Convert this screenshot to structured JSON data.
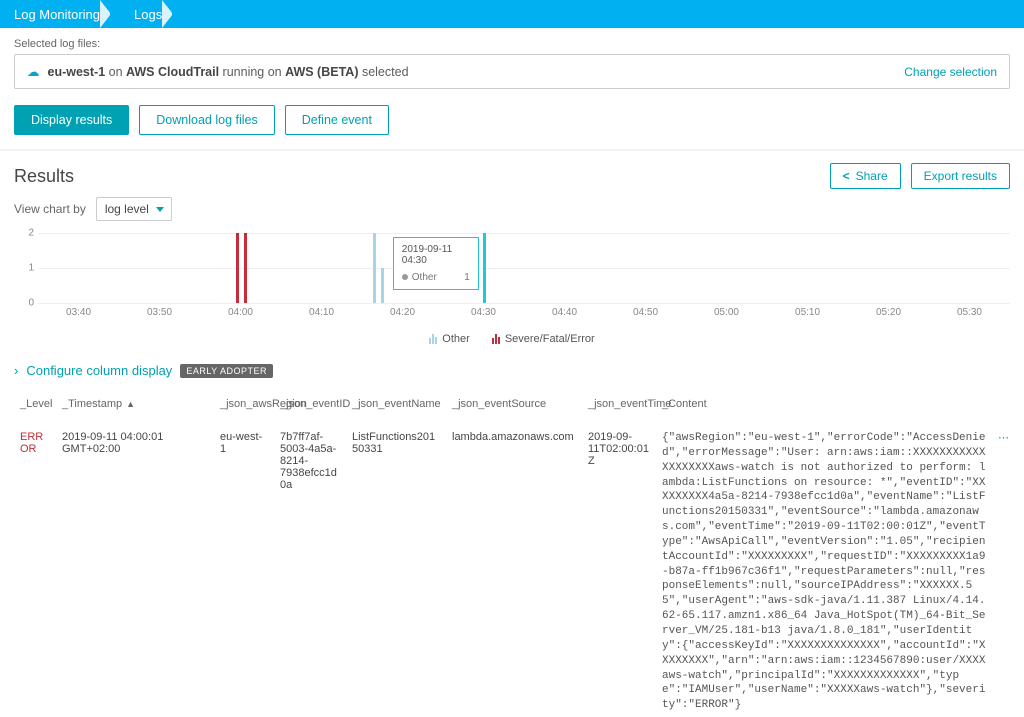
{
  "breadcrumb": {
    "items": [
      "Log Monitoring",
      "Logs"
    ]
  },
  "selbox": {
    "label": "Selected log files:",
    "text_prefix": "eu-west-1",
    "text_mid1": " on ",
    "text_bold1": "AWS CloudTrail",
    "text_mid2": " running on ",
    "text_bold2": "AWS (BETA)",
    "text_suffix": " selected",
    "change": "Change selection"
  },
  "actions": {
    "display": "Display results",
    "download": "Download log files",
    "define": "Define event"
  },
  "results": {
    "title": "Results",
    "share": "Share",
    "export": "Export results",
    "view_label": "View chart by",
    "view_value": "log level"
  },
  "chart_data": {
    "type": "bar",
    "yticks": [
      0,
      1,
      2
    ],
    "ylim": [
      0,
      2
    ],
    "xticks": [
      "03:40",
      "03:50",
      "04:00",
      "04:10",
      "04:20",
      "04:30",
      "04:40",
      "04:50",
      "05:00",
      "05:10",
      "05:20",
      "05:30"
    ],
    "x_range_min": "03:35",
    "x_range_max": "05:35",
    "bars": [
      {
        "time": "04:00",
        "series": "severe",
        "value": 2,
        "offset": -1
      },
      {
        "time": "04:00",
        "series": "severe",
        "value": 2,
        "offset": 1
      },
      {
        "time": "04:17",
        "series": "other",
        "value": 2,
        "offset": 0
      },
      {
        "time": "04:18",
        "series": "other",
        "value": 1,
        "offset": 0
      },
      {
        "time": "04:30",
        "series": "hover",
        "value": 2,
        "offset": 0
      }
    ],
    "legend": [
      {
        "label": "Other",
        "color": "#a7d4e6"
      },
      {
        "label": "Severe/Fatal/Error",
        "color": "#c52d3d"
      }
    ],
    "tooltip": {
      "title": "2019-09-11 04:30",
      "row_label": "Other",
      "row_value": "1"
    }
  },
  "configure": {
    "label": "Configure column display",
    "badge": "EARLY ADOPTER"
  },
  "table": {
    "columns": {
      "level": "_Level",
      "timestamp": "_Timestamp",
      "region": "_json_awsRegion",
      "eventID": "_json_eventID",
      "eventName": "_json_eventName",
      "eventSource": "_json_eventSource",
      "eventTime": "_json_eventTime",
      "content": "_Content"
    },
    "rows": [
      {
        "level": "ERROR",
        "timestamp": "2019-09-11 04:00:01 GMT+02:00",
        "region": "eu-west-1",
        "eventID": "7b7ff7af-5003-4a5a-8214-7938efcc1d0a",
        "eventName": "ListFunctions20150331",
        "eventSource": "lambda.amazonaws.com",
        "eventTime": "2019-09-11T02:00:01Z",
        "content": "{\"awsRegion\":\"eu-west-1\",\"errorCode\":\"AccessDenied\",\"errorMessage\":\"User: arn:aws:iam::XXXXXXXXXXXXXXXXXXXaws-watch is not authorized to perform: lambda:ListFunctions on resource: *\",\"eventID\":\"XXXXXXXXX4a5a-8214-7938efcc1d0a\",\"eventName\":\"ListFunctions20150331\",\"eventSource\":\"lambda.amazonaws.com\",\"eventTime\":\"2019-09-11T02:00:01Z\",\"eventType\":\"AwsApiCall\",\"eventVersion\":\"1.05\",\"recipientAccountId\":\"XXXXXXXXX\",\"requestID\":\"XXXXXXXXX1a9-b87a-ff1b967c36f1\",\"requestParameters\":null,\"responseElements\":null,\"sourceIPAddress\":\"XXXXXX.55\",\"userAgent\":\"aws-sdk-java/1.11.387 Linux/4.14.62-65.117.amzn1.x86_64 Java_HotSpot(TM)_64-Bit_Server_VM/25.181-b13 java/1.8.0_181\",\"userIdentity\":{\"accessKeyId\":\"XXXXXXXXXXXXXX\",\"accountId\":\"XXXXXXXX\",\"arn\":\"arn:aws:iam::1234567890:user/XXXXaws-watch\",\"principalId\":\"XXXXXXXXXXXXX\",\"type\":\"IAMUser\",\"userName\":\"XXXXXaws-watch\"},\"severity\":\"ERROR\"}"
      }
    ]
  }
}
